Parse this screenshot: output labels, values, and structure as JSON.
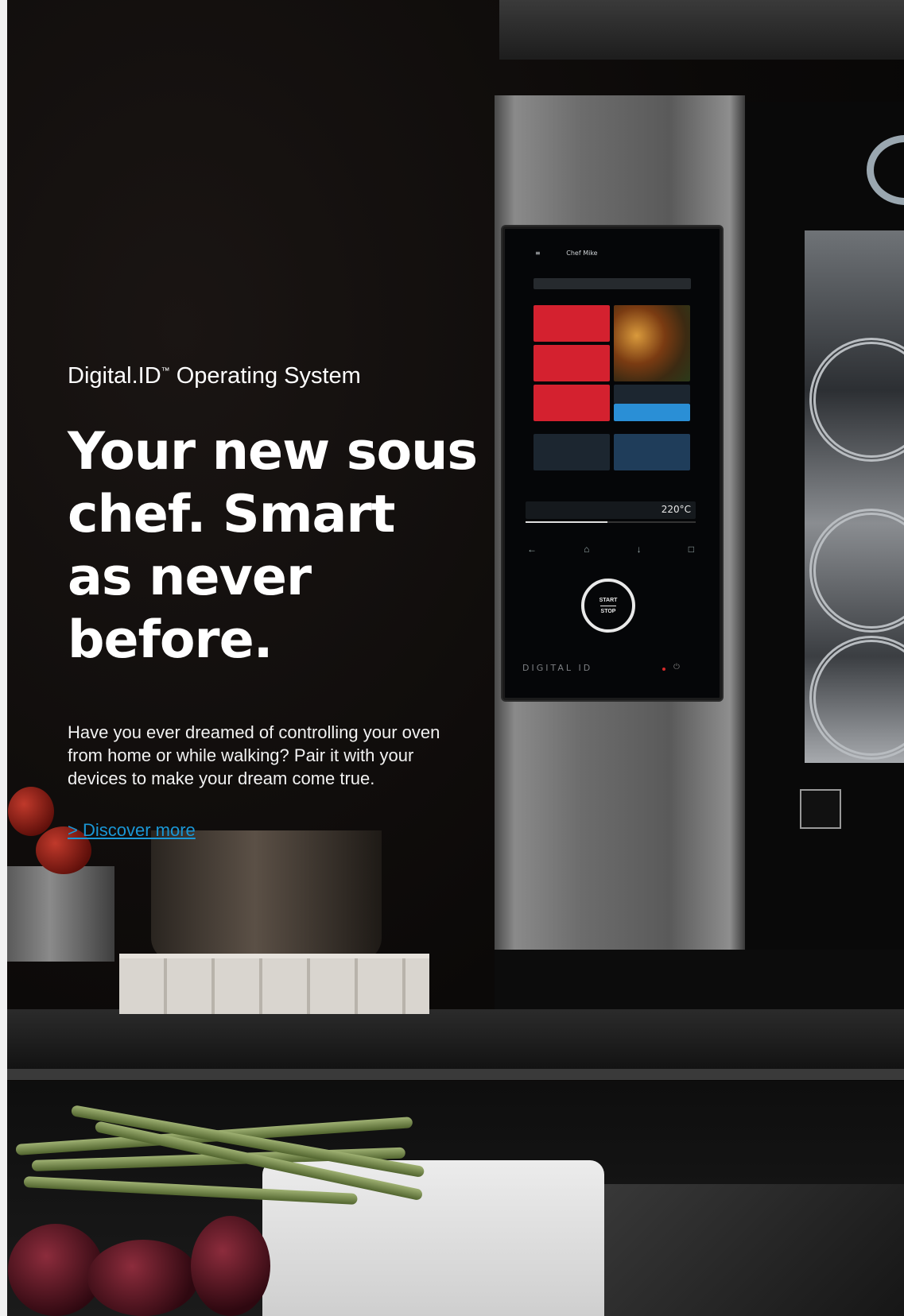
{
  "brand": {
    "eyebrow": "Digital.ID",
    "trademark": "™",
    "eyebrow_suffix": " Operating System"
  },
  "hero": {
    "headline_line1": "Your new sous",
    "headline_line2": "chef. Smart",
    "headline_line3": "as never before.",
    "body": "Have you ever dreamed of controlling your oven from home or while walking? Pair it with your devices to make your dream come true.",
    "cta_label": "> Discover more"
  },
  "oven_screen": {
    "user_name": "Chef Mike",
    "temperature": "220°C",
    "start_stop_label_top": "START",
    "start_stop_label_bottom": "STOP",
    "logo_text": "DIGITAL ID",
    "progress_fraction": 0.48
  },
  "colors": {
    "cta_blue": "#1a97d6",
    "tile_red": "#d4212f",
    "tile_blue": "#2a8fd6"
  }
}
